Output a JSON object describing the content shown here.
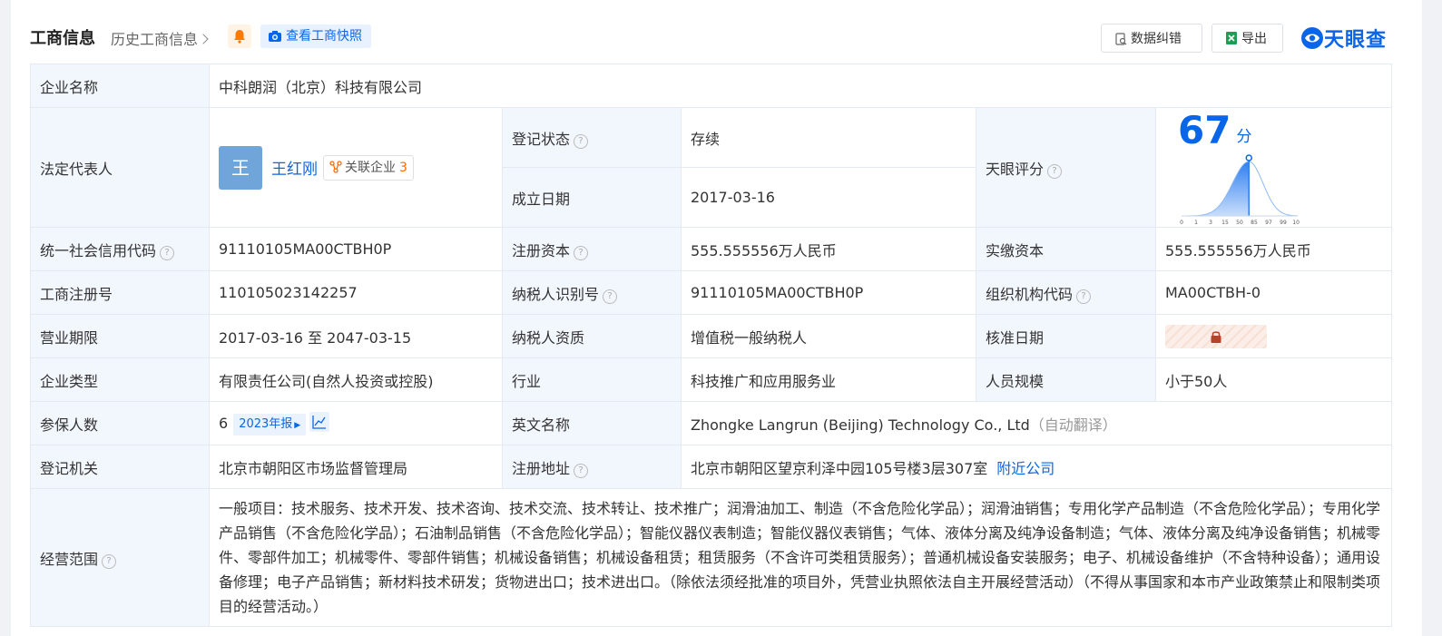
{
  "header": {
    "title": "工商信息",
    "history_link": "历史工商信息",
    "snapshot_label": "查看工商快照",
    "correct_label": "数据纠错",
    "export_label": "导出",
    "brand": "天眼查"
  },
  "rows": {
    "company_name": {
      "label": "企业名称",
      "value": "中科朗润（北京）科技有限公司"
    },
    "legal_rep": {
      "label": "法定代表人",
      "avatar": "王",
      "name": "王红刚",
      "related_label": "关联企业",
      "related_count": "3"
    },
    "reg_status": {
      "label": "登记状态",
      "value": "存续"
    },
    "founded": {
      "label": "成立日期",
      "value": "2017-03-16"
    },
    "tianyan_score": {
      "label": "天眼评分",
      "score": "67",
      "unit": "分"
    },
    "credit_code": {
      "label": "统一社会信用代码",
      "value": "91110105MA00CTBH0P"
    },
    "reg_capital": {
      "label": "注册资本",
      "value": "555.555556万人民币"
    },
    "paid_capital": {
      "label": "实缴资本",
      "value": "555.555556万人民币"
    },
    "reg_no": {
      "label": "工商注册号",
      "value": "110105023142257"
    },
    "taxpayer_id": {
      "label": "纳税人识别号",
      "value": "91110105MA00CTBH0P"
    },
    "org_code": {
      "label": "组织机构代码",
      "value": "MA00CTBH-0"
    },
    "term": {
      "label": "营业期限",
      "value": "2017-03-16 至 2047-03-15"
    },
    "taxpayer_qual": {
      "label": "纳税人资质",
      "value": "增值税一般纳税人"
    },
    "approval_date": {
      "label": "核准日期"
    },
    "company_type": {
      "label": "企业类型",
      "value": "有限责任公司(自然人投资或控股)"
    },
    "industry": {
      "label": "行业",
      "value": "科技推广和应用服务业"
    },
    "staff_size": {
      "label": "人员规模",
      "value": "小于50人"
    },
    "insured": {
      "label": "参保人数",
      "value": "6",
      "year_badge": "2023年报"
    },
    "english_name": {
      "label": "英文名称",
      "value": "Zhongke Langrun (Beijing) Technology Co., Ltd",
      "note": "（自动翻译）"
    },
    "reg_authority": {
      "label": "登记机关",
      "value": "北京市朝阳区市场监督管理局"
    },
    "reg_address": {
      "label": "注册地址",
      "value": "北京市朝阳区望京利泽中园105号楼3层307室",
      "nearby": "附近公司"
    },
    "scope": {
      "label": "经营范围",
      "value": "一般项目：技术服务、技术开发、技术咨询、技术交流、技术转让、技术推广；润滑油加工、制造（不含危险化学品）；润滑油销售；专用化学产品制造（不含危险化学品）；专用化学产品销售（不含危险化学品）；石油制品销售（不含危险化学品）；智能仪器仪表制造；智能仪器仪表销售；气体、液体分离及纯净设备制造；气体、液体分离及纯净设备销售；机械零件、零部件加工；机械零件、零部件销售；机械设备销售；机械设备租赁；租赁服务（不含许可类租赁服务）；普通机械设备安装服务；电子、机械设备维护（不含特种设备）；通用设备修理；电子产品销售；新材料技术研发；货物进出口；技术进出口。（除依法须经批准的项目外，凭营业执照依法自主开展经营活动）（不得从事国家和本市产业政策禁止和限制类项目的经营活动。）"
    }
  },
  "score_chart": {
    "ticks": [
      "0",
      "1",
      "3",
      "15",
      "50",
      "85",
      "97",
      "99",
      "100"
    ],
    "marker_fraction": 0.58
  },
  "colors": {
    "accent": "#0a66e8",
    "label_bg": "#f2f7fe",
    "status_green": "#00a650",
    "count_orange": "#ff6a00"
  },
  "icons": [
    "bell-icon",
    "camera-icon",
    "correct-icon",
    "excel-icon",
    "tianyancha-logo",
    "help-icon",
    "related-icon",
    "trend-icon",
    "lock-icon"
  ]
}
